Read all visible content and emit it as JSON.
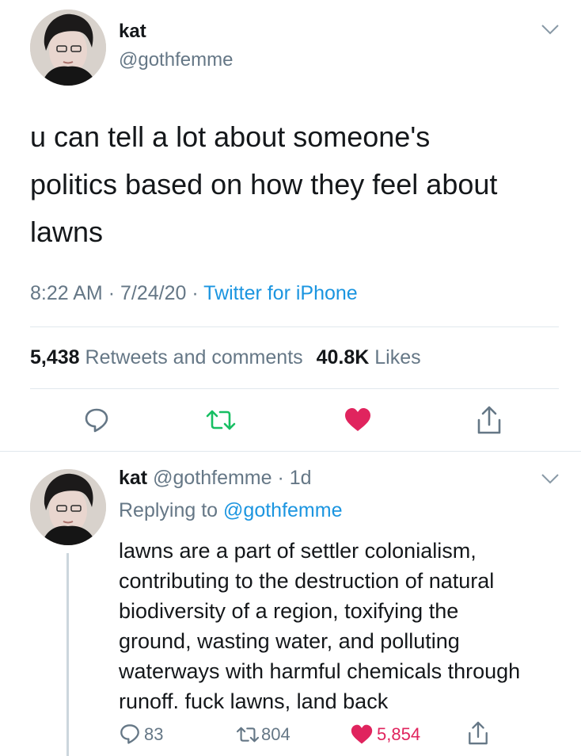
{
  "main_tweet": {
    "name": "kat",
    "handle": "@gothfemme",
    "text_line1": "u can tell a lot about someone's",
    "text_line2": "politics based on how they feel about",
    "text_line3": "lawns",
    "time": "8:22 AM",
    "date": "7/24/20",
    "source": "Twitter for iPhone",
    "retweets_count": "5,438",
    "retweets_label": "Retweets and comments",
    "likes_count": "40.8K",
    "likes_label": "Likes"
  },
  "reply": {
    "name": "kat",
    "handle": "@gothfemme",
    "age": "1d",
    "replying_to_prefix": "Replying to",
    "replying_to_handle": "@gothfemme",
    "lines": [
      "lawns are a part of settler colonialism,",
      "contributing to the destruction of natural",
      "biodiversity of a region, toxifying the",
      "ground, wasting water, and polluting",
      "waterways with harmful chemicals through",
      "runoff. fuck lawns, land back"
    ],
    "reply_count": "83",
    "retweet_count": "804",
    "like_count": "5,854"
  },
  "colors": {
    "retweet_green": "#17bf63",
    "like_red": "#e0245e",
    "icon_gray": "#657786",
    "link_blue": "#1b95e0"
  },
  "icons": {
    "reply": "reply-icon",
    "retweet": "retweet-icon",
    "like": "heart-icon",
    "share": "share-icon",
    "menu": "chevron-down-icon"
  }
}
